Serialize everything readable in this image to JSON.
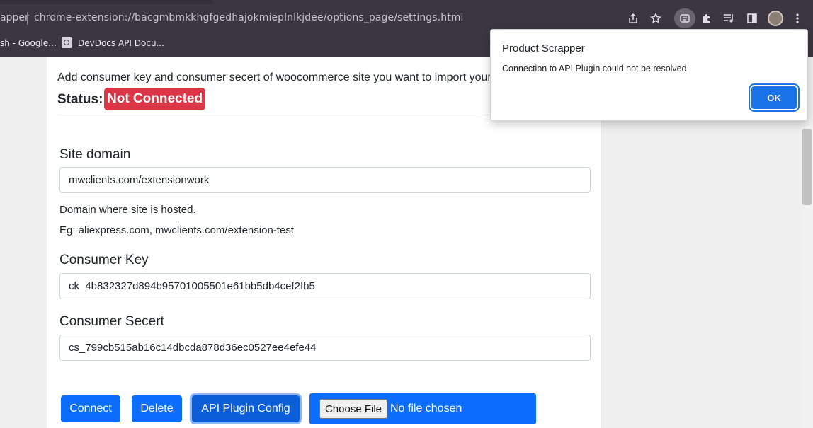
{
  "browser": {
    "tab_fragment": "apper",
    "url": "chrome-extension://bacgmbmkkhgfgedhajokmieplnlkjdee/options_page/settings.html",
    "bookmarks": [
      {
        "label": "sh - Google..."
      },
      {
        "label": "DevDocs API Docu..."
      }
    ],
    "toolbar_icons": [
      "share-icon",
      "star-icon",
      "extension-active-icon",
      "puzzle-icon",
      "media-icon",
      "sidebar-icon",
      "avatar",
      "menu-icon"
    ]
  },
  "page": {
    "intro": "Add consumer key and consumer secert of woocommerce site you want to import your",
    "status_label": "Status:",
    "status_value": "Not Connected",
    "status_color": "#dc3545",
    "fields": {
      "site_domain": {
        "label": "Site domain",
        "value": "mwclients.com/extensionwork",
        "help1": "Domain where site is hosted.",
        "help2": "Eg: aliexpress.com, mwclients.com/extension-test"
      },
      "consumer_key": {
        "label": "Consumer Key",
        "value": "ck_4b832327d894b95701005501e61bb5db4cef2fb5"
      },
      "consumer_secret": {
        "label": "Consumer Secert",
        "value": "cs_799cb515ab16c14dbcda878d36ec0527ee4efe44"
      }
    },
    "buttons": {
      "connect": "Connect",
      "delete": "Delete",
      "api_config": "API Plugin Config",
      "choose_file": "Choose File",
      "file_status": "No file chosen"
    },
    "accent_color": "#0d6efd"
  },
  "dialog": {
    "title": "Product Scrapper",
    "message": "Connection to API Plugin could not be resolved",
    "ok": "OK"
  }
}
